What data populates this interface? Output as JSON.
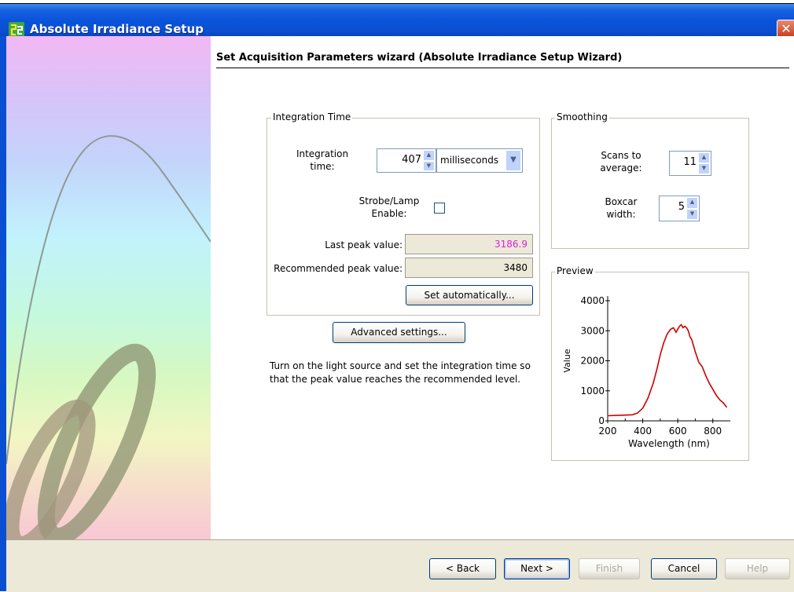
{
  "window": {
    "title": "Absolute Irradiance Setup",
    "close_glyph": "✕"
  },
  "wizard": {
    "heading": "Set Acquisition Parameters wizard (Absolute Irradiance Setup Wizard)",
    "info_text": "Turn on the light source and set the integration time so that the peak value reaches the recommended level."
  },
  "integration_group": {
    "label": "Integration Time",
    "integration_time_label_1": "Integration",
    "integration_time_label_2": "time:",
    "integration_time_value": "407",
    "units_value": "milliseconds",
    "strobe_label_1": "Strobe/Lamp",
    "strobe_label_2": "Enable:",
    "strobe_checked": false,
    "last_peak_label": "Last peak value:",
    "last_peak_value": "3186.9",
    "last_peak_color": "#E020E0",
    "recommended_peak_label": "Recommended peak value:",
    "recommended_peak_value": "3480",
    "set_auto_label": "Set automatically..."
  },
  "advanced_settings_label": "Advanced settings...",
  "smoothing_group": {
    "label": "Smoothing",
    "scans_label_1": "Scans to",
    "scans_label_2": "average:",
    "scans_value": "11",
    "boxcar_label_1": "Boxcar",
    "boxcar_label_2": "width:",
    "boxcar_value": "5"
  },
  "preview_group": {
    "label": "Preview"
  },
  "chart_data": {
    "type": "line",
    "title": "",
    "xlabel": "Wavelength (nm)",
    "ylabel": "Value",
    "xlim": [
      200,
      900
    ],
    "ylim": [
      0,
      4000
    ],
    "xticks": [
      200,
      400,
      600,
      800
    ],
    "yticks": [
      0,
      1000,
      2000,
      3000,
      4000
    ],
    "line_color": "#CC0000",
    "series": [
      {
        "x": [
          200,
          250,
          300,
          340,
          370,
          400,
          430,
          460,
          480,
          500,
          520,
          540,
          560,
          575,
          590,
          600,
          610,
          620,
          630,
          640,
          650,
          660,
          670,
          680,
          700,
          720,
          740,
          760,
          780,
          800,
          820,
          840,
          860,
          880
        ],
        "y": [
          170,
          180,
          190,
          200,
          260,
          420,
          760,
          1250,
          1700,
          2200,
          2600,
          2900,
          3050,
          3100,
          2950,
          3050,
          3150,
          3200,
          3100,
          3150,
          3100,
          3000,
          2800,
          2700,
          2300,
          1950,
          1800,
          1500,
          1250,
          1050,
          850,
          700,
          600,
          450
        ]
      }
    ]
  },
  "footer": {
    "back_label": "< Back",
    "next_label": "Next >",
    "finish_label": "Finish",
    "cancel_label": "Cancel",
    "help_label": "Help"
  },
  "colors": {
    "titlebar": "#0A4FD2",
    "face": "#ECE9D8"
  }
}
